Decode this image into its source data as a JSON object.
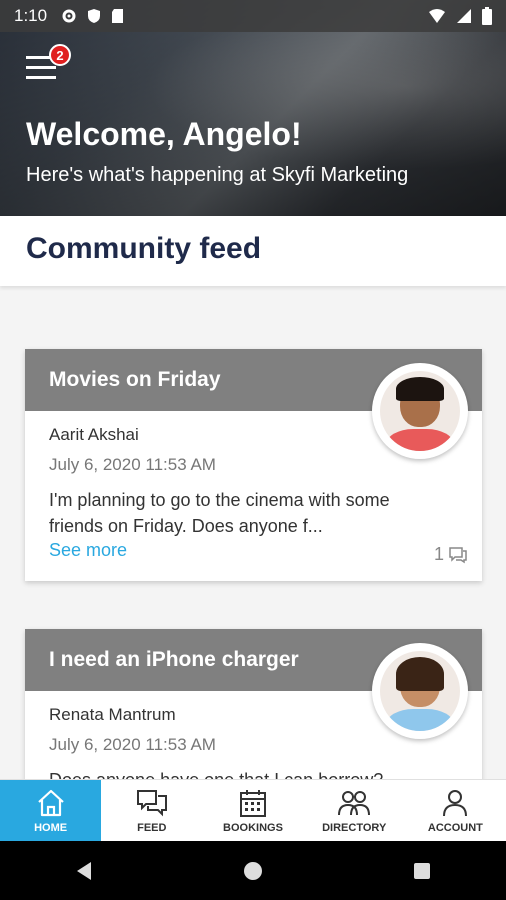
{
  "status_bar": {
    "time": "1:10"
  },
  "hero": {
    "badge_count": "2",
    "welcome": "Welcome, Angelo!",
    "subtitle": "Here's what's happening at Skyfi Marketing"
  },
  "feed": {
    "title": "Community feed"
  },
  "posts": [
    {
      "title": "Movies on Friday",
      "author": "Aarit Akshai",
      "date": "July 6, 2020 11:53 AM",
      "body": "I'm planning to go to the cinema with some friends on Friday. Does anyone f...",
      "see_more": "See more",
      "comments": "1"
    },
    {
      "title": "I need an iPhone charger",
      "author": "Renata Mantrum",
      "date": "July 6, 2020 11:53 AM",
      "body": "Does anyone have one that I can borrow?"
    }
  ],
  "nav": [
    {
      "label": "HOME",
      "icon": "home-icon"
    },
    {
      "label": "FEED",
      "icon": "chat-icon"
    },
    {
      "label": "BOOKINGS",
      "icon": "calendar-icon"
    },
    {
      "label": "DIRECTORY",
      "icon": "people-icon"
    },
    {
      "label": "ACCOUNT",
      "icon": "person-icon"
    }
  ],
  "colors": {
    "accent": "#29a8e0",
    "title_navy": "#1f2a4a",
    "card_header": "#808080",
    "badge": "#e02020"
  }
}
